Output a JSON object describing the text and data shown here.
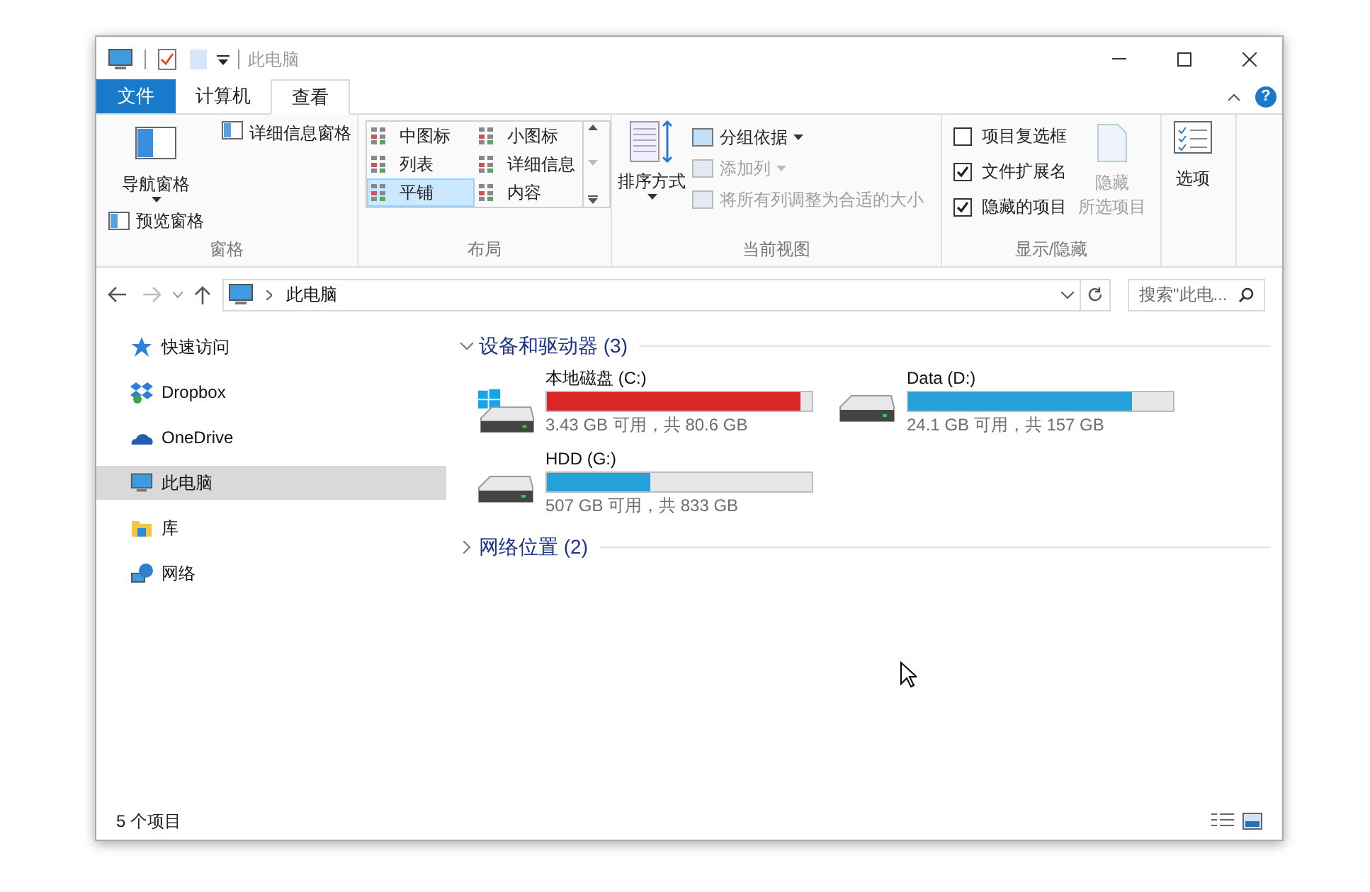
{
  "window": {
    "title": "此电脑"
  },
  "tabs": [
    {
      "label": "文件",
      "kind": "file",
      "selected": false
    },
    {
      "label": "计算机",
      "kind": "tab",
      "selected": false
    },
    {
      "label": "查看",
      "kind": "tab",
      "selected": true
    }
  ],
  "help": "?",
  "ribbon": {
    "groups": [
      {
        "label": "窗格",
        "kind": "panes",
        "large": {
          "label": "导航窗格"
        },
        "items": [
          {
            "label": "预览窗格"
          },
          {
            "label": "详细信息窗格"
          }
        ]
      },
      {
        "label": "布局",
        "kind": "layout",
        "items": [
          {
            "label": "中图标",
            "selected": false
          },
          {
            "label": "小图标",
            "selected": false
          },
          {
            "label": "列表",
            "selected": false
          },
          {
            "label": "详细信息",
            "selected": false
          },
          {
            "label": "平铺",
            "selected": true
          },
          {
            "label": "内容",
            "selected": false
          }
        ]
      },
      {
        "label": "当前视图",
        "kind": "view",
        "large": {
          "label": "排序方式"
        },
        "items": [
          {
            "label": "分组依据",
            "disabled": false,
            "dropdown": true
          },
          {
            "label": "添加列",
            "disabled": true,
            "dropdown": true
          },
          {
            "label": "将所有列调整为合适的大小",
            "disabled": true,
            "dropdown": false
          }
        ]
      },
      {
        "label": "显示/隐藏",
        "kind": "showhide",
        "items": [
          {
            "label": "项目复选框",
            "checked": false
          },
          {
            "label": "文件扩展名",
            "checked": true
          },
          {
            "label": "隐藏的项目",
            "checked": true
          }
        ],
        "large": {
          "lines": [
            "隐藏",
            "所选项目"
          ],
          "disabled": true
        }
      },
      {
        "kind": "options",
        "large": {
          "label": "选项"
        }
      }
    ]
  },
  "address": {
    "path": "此电脑",
    "search_placeholder": "搜索\"此电..."
  },
  "sidebar": {
    "items": [
      {
        "label": "快速访问",
        "kind": "star",
        "selected": false
      },
      {
        "label": "Dropbox",
        "kind": "dropbox",
        "selected": false
      },
      {
        "label": "OneDrive",
        "kind": "cloud",
        "selected": false
      },
      {
        "label": "此电脑",
        "kind": "pc",
        "selected": true
      },
      {
        "label": "库",
        "kind": "library",
        "selected": false
      },
      {
        "label": "网络",
        "kind": "network",
        "selected": false
      }
    ]
  },
  "groups": [
    {
      "title": "设备和驱动器 (3)",
      "expanded": true,
      "drives": [
        {
          "name": "本地磁盘 (C:)",
          "system": true,
          "level": 0.957,
          "info": "3.43 GB 可用，共 80.6 GB"
        },
        {
          "name": "Data (D:)",
          "system": false,
          "level": 0.846,
          "info": "24.1 GB 可用，共 157 GB"
        },
        {
          "name": "HDD (G:)",
          "system": false,
          "level": 0.39,
          "info": "507 GB 可用，共 833 GB"
        }
      ]
    },
    {
      "title": "网络位置 (2)",
      "expanded": false
    }
  ],
  "status_bar": {
    "count": "5 个项目"
  }
}
